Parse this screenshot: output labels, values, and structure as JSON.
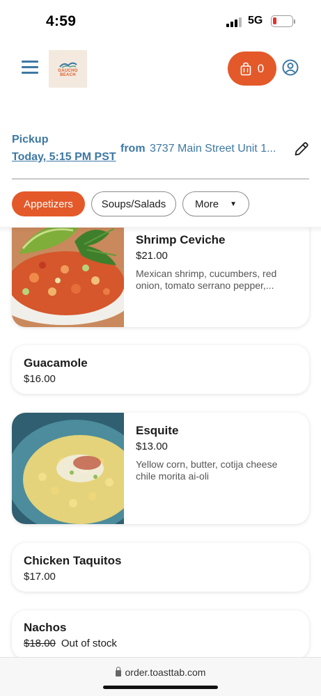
{
  "status_bar": {
    "time": "4:59",
    "network": "5G"
  },
  "header": {
    "logo_line1": "GAUCHO",
    "logo_line2": "BEACH",
    "cart_count": "0"
  },
  "pickup": {
    "label": "Pickup",
    "time": "Today, 5:15 PM PST",
    "from_label": "from",
    "address": "3737 Main Street Unit 1..."
  },
  "tabs": [
    {
      "label": "Appetizers",
      "active": true
    },
    {
      "label": "Soups/Salads",
      "active": false
    },
    {
      "label": "More",
      "active": false
    }
  ],
  "menu_items": [
    {
      "name": "Shrimp Ceviche",
      "price": "$21.00",
      "description": "Mexican shrimp, cucumbers, red onion, tomato serrano pepper,..."
    },
    {
      "name": "Guacamole",
      "price": "$16.00"
    },
    {
      "name": "Esquite",
      "price": "$13.00",
      "description": "Yellow corn, butter, cotija cheese chile morita ai-oli"
    },
    {
      "name": "Chicken Taquitos",
      "price": "$17.00"
    },
    {
      "name": "Nachos",
      "price": "$18.00",
      "status": "Out of stock"
    }
  ],
  "browser": {
    "url": "order.toasttab.com"
  },
  "colors": {
    "accent": "#e4592a",
    "link": "#3d78a4",
    "battery_low": "#e5322d"
  }
}
